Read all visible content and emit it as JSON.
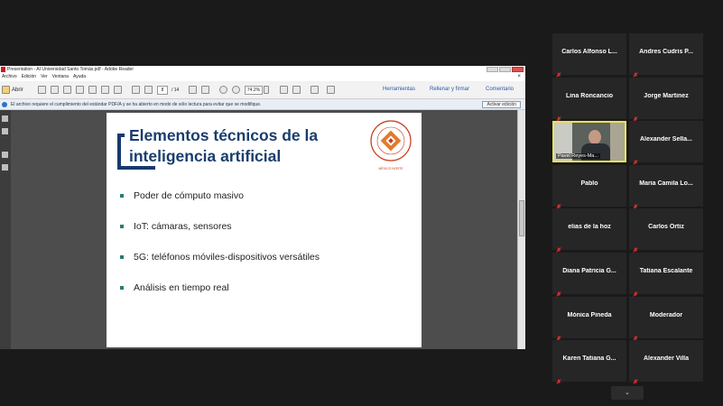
{
  "reader": {
    "title": "Presentation - AI Universidad Santo Tomás.pdf - Adobe Reader",
    "menu": [
      "Archivo",
      "Edición",
      "Ver",
      "Ventana",
      "Ayuda"
    ],
    "menu_close": "×",
    "toolbar": {
      "open_label": "Abrir",
      "page_current": "8",
      "page_total": "/ 14",
      "zoom": "74.2%",
      "tools": "Herramientas",
      "sign": "Rellenar y firmar",
      "comment": "Comentario"
    },
    "notice": {
      "text": "El archivo requiere el cumplimiento del estándar PDF/A y se ha abierto en modo de sólo lectura para evitar que se modifique.",
      "button": "Activar edición"
    }
  },
  "slide": {
    "title_line1": "Elementos técnicos de la",
    "title_line2": "inteligencia artificial",
    "logo_caption": "MÉXICO NORTE",
    "bullets": [
      "Poder de cómputo masivo",
      "IoT: cámaras, sensores",
      "5G: teléfonos móviles-dispositivos versátiles",
      "Análisis en tiempo real"
    ]
  },
  "participants": [
    {
      "name": "Carlos Alfonso L..."
    },
    {
      "name": "Andres Cudris P..."
    },
    {
      "name": "Lina Roncancio"
    },
    {
      "name": "Jorge Martinez"
    },
    {
      "name": "Pavel Reyes-Ma...",
      "video": true
    },
    {
      "name": "Alexander Sella..."
    },
    {
      "name": "Pablo"
    },
    {
      "name": "Maria Camila Lo..."
    },
    {
      "name": "elias de la hoz"
    },
    {
      "name": "Carlos Ortiz"
    },
    {
      "name": "Diana Patricia G..."
    },
    {
      "name": "Tatiana Escalante"
    },
    {
      "name": "Mónica Pineda"
    },
    {
      "name": "Moderador"
    },
    {
      "name": "Karen Tatiana G..."
    },
    {
      "name": "Alexander Villa"
    }
  ],
  "panel_toggle_icon": "chevron-down-icon",
  "colors": {
    "title_blue": "#1a3d6e",
    "bullet_teal": "#2a7a74",
    "muted_mic": "#e0302a",
    "active_speaker": "#e8e35a"
  }
}
